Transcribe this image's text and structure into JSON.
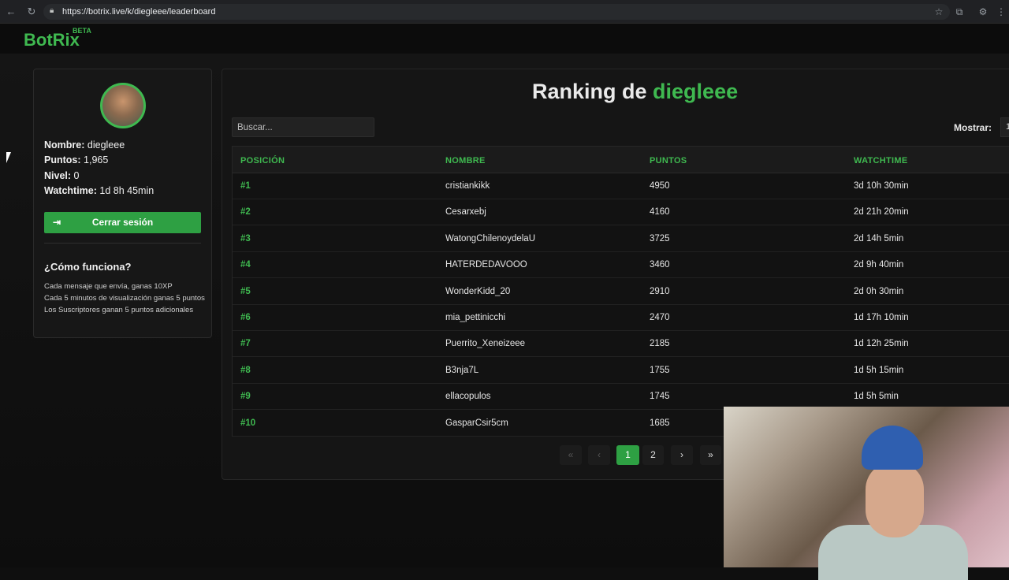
{
  "browser": {
    "url": "https://botrix.live/k/diegleee/leaderboard"
  },
  "site": {
    "logo": "BotRix",
    "beta": "BETA"
  },
  "profile": {
    "name_label": "Nombre:",
    "name_value": "diegleee",
    "points_label": "Puntos:",
    "points_value": "1,965",
    "level_label": "Nivel:",
    "level_value": "0",
    "watchtime_label": "Watchtime:",
    "watchtime_value": "1d 8h 45min",
    "logout_label": "Cerrar sesión",
    "how_title": "¿Cómo funciona?",
    "how_lines": [
      "Cada mensaje que envía, ganas 10XP",
      "Cada 5 minutos de visualización ganas 5 puntos",
      "Los Suscriptores ganan 5 puntos adicionales"
    ]
  },
  "ranking": {
    "title_prefix": "Ranking de",
    "title_user": "diegleee",
    "search_placeholder": "Buscar...",
    "show_label": "Mostrar:",
    "show_value": "1",
    "headers": [
      "POSICIÓN",
      "NOMBRE",
      "PUNTOS",
      "WATCHTIME"
    ],
    "rows": [
      {
        "pos": "#1",
        "name": "cristiankikk",
        "points": "4950",
        "watchtime": "3d 10h 30min"
      },
      {
        "pos": "#2",
        "name": "Cesarxebj",
        "points": "4160",
        "watchtime": "2d 21h 20min"
      },
      {
        "pos": "#3",
        "name": "WatongChilenoydelaU",
        "points": "3725",
        "watchtime": "2d 14h 5min"
      },
      {
        "pos": "#4",
        "name": "HATERDEDAVOOO",
        "points": "3460",
        "watchtime": "2d 9h 40min"
      },
      {
        "pos": "#5",
        "name": "WonderKidd_20",
        "points": "2910",
        "watchtime": "2d 0h 30min"
      },
      {
        "pos": "#6",
        "name": "mia_pettinicchi",
        "points": "2470",
        "watchtime": "1d 17h 10min"
      },
      {
        "pos": "#7",
        "name": "Puerrito_Xeneizeee",
        "points": "2185",
        "watchtime": "1d 12h 25min"
      },
      {
        "pos": "#8",
        "name": "B3nja7L",
        "points": "1755",
        "watchtime": "1d 5h 15min"
      },
      {
        "pos": "#9",
        "name": "ellacopulos",
        "points": "1745",
        "watchtime": "1d 5h 5min"
      },
      {
        "pos": "#10",
        "name": "GasparCsir5cm",
        "points": "1685",
        "watchtime": ""
      }
    ],
    "pagination": {
      "first": "«",
      "prev": "‹",
      "pages": [
        "1",
        "2"
      ],
      "next": "›",
      "last": "»"
    }
  },
  "icons": {
    "back": "arrow-left-icon",
    "reload": "reload-icon",
    "lock": "lock-icon",
    "star": "star-icon",
    "extensions": "puzzle-icon",
    "logout": "logout-icon"
  },
  "colors": {
    "accent": "#3fb950",
    "button": "#2ea043",
    "background": "#0f0f0f"
  }
}
